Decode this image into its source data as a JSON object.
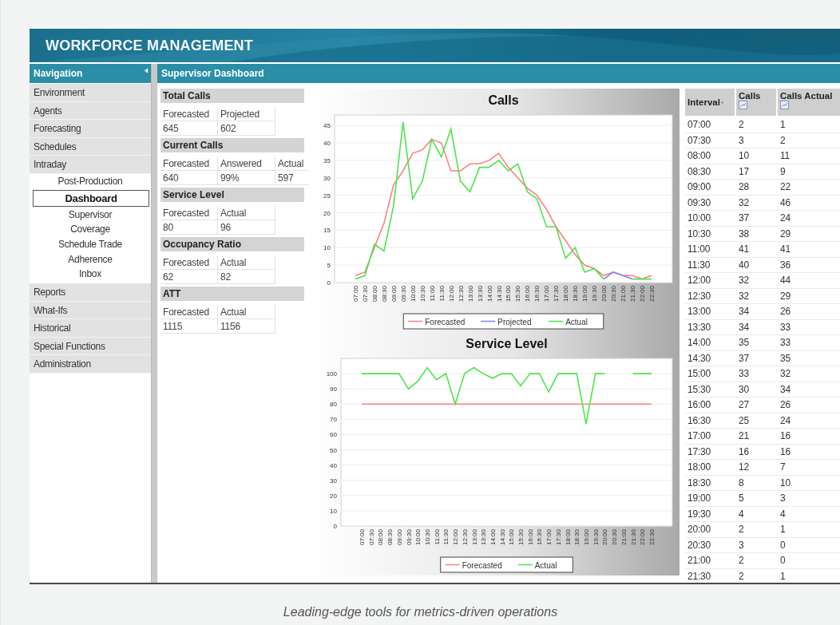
{
  "header": {
    "title": "WORKFORCE MANAGEMENT"
  },
  "navigation": {
    "title": "Navigation",
    "items": [
      {
        "label": "Environment",
        "selected": false
      },
      {
        "label": "Agents",
        "selected": false
      },
      {
        "label": "Forecasting",
        "selected": false
      },
      {
        "label": "Schedules",
        "selected": false
      },
      {
        "label": "Intraday",
        "selected": false,
        "children": [
          {
            "label": "Post-Production",
            "selected": false
          },
          {
            "label": "Dashboard",
            "selected": true
          },
          {
            "label": "Supervisor",
            "selected": false
          },
          {
            "label": "Coverage",
            "selected": false
          },
          {
            "label": "Schedule Trade",
            "selected": false
          },
          {
            "label": "Adherence",
            "selected": false
          },
          {
            "label": "Inbox",
            "selected": false
          }
        ]
      },
      {
        "label": "Reports",
        "selected": false
      },
      {
        "label": "What-Ifs",
        "selected": false
      },
      {
        "label": "Historical",
        "selected": false
      },
      {
        "label": "Special Functions",
        "selected": false
      },
      {
        "label": "Administration",
        "selected": false
      }
    ]
  },
  "panel": {
    "title": "Supervisor Dashboard"
  },
  "metrics": [
    {
      "title": "Total Calls",
      "columns": [
        "Forecasted",
        "Projected"
      ],
      "values": [
        "645",
        "602"
      ]
    },
    {
      "title": "Current Calls",
      "columns": [
        "Forecasted",
        "Answered",
        "Actual"
      ],
      "values": [
        "640",
        "99%",
        "597"
      ]
    },
    {
      "title": "Service Level",
      "columns": [
        "Forecasted",
        "Actual"
      ],
      "values": [
        "80",
        "96"
      ]
    },
    {
      "title": "Occupancy Ratio",
      "columns": [
        "Forecasted",
        "Actual"
      ],
      "values": [
        "62",
        "82"
      ]
    },
    {
      "title": "ATT",
      "columns": [
        "Forecasted",
        "Actual"
      ],
      "values": [
        "1115",
        "1156"
      ]
    }
  ],
  "charts": [
    {
      "chart_data": {
        "type": "line",
        "title": "Calls",
        "categories": [
          "07:00",
          "07:30",
          "08:00",
          "08:30",
          "09:00",
          "09:30",
          "10:00",
          "10:30",
          "11:00",
          "11:30",
          "12:00",
          "12:30",
          "13:00",
          "13:30",
          "14:00",
          "14:30",
          "15:00",
          "15:30",
          "16:00",
          "16:30",
          "17:00",
          "17:30",
          "18:00",
          "18:30",
          "19:00",
          "19:30",
          "20:00",
          "20:30",
          "21:00",
          "21:30",
          "22:00",
          "22:30"
        ],
        "series": [
          {
            "name": "Forecasted",
            "color": "#ff7f7f",
            "values": [
              2,
              3,
              10,
              17,
              28,
              32,
              37,
              38,
              41,
              40,
              32,
              32,
              34,
              34,
              35,
              37,
              33,
              30,
              27,
              25,
              21,
              16,
              12,
              8,
              5,
              4,
              2,
              3,
              2,
              2,
              1,
              2
            ]
          },
          {
            "name": "Projected",
            "color": "#7f7fff",
            "values": [
              null,
              null,
              null,
              null,
              null,
              null,
              null,
              null,
              null,
              null,
              null,
              null,
              null,
              null,
              null,
              null,
              null,
              null,
              null,
              null,
              null,
              null,
              null,
              null,
              null,
              null,
              1,
              3,
              2,
              1,
              null,
              null
            ]
          },
          {
            "name": "Actual",
            "color": "#4ee44e",
            "values": [
              1,
              2,
              11,
              9,
              22,
              46,
              24,
              29,
              41,
              36,
              44,
              29,
              26,
              33,
              33,
              35,
              32,
              34,
              26,
              24,
              16,
              16,
              7,
              10,
              3,
              4,
              1,
              null,
              null,
              1,
              1,
              1
            ]
          }
        ],
        "ylim": [
          0,
          48
        ],
        "yticks": [
          0,
          5,
          10,
          15,
          20,
          25,
          30,
          35,
          40,
          45
        ],
        "grid": true,
        "legend": "bottom"
      }
    },
    {
      "chart_data": {
        "type": "line",
        "title": "Service Level",
        "categories": [
          "07:00",
          "07:30",
          "08:00",
          "08:30",
          "09:00",
          "09:30",
          "10:00",
          "10:30",
          "11:00",
          "11:30",
          "12:00",
          "12:30",
          "13:00",
          "13:30",
          "14:00",
          "14:30",
          "15:00",
          "15:30",
          "16:00",
          "16:30",
          "17:00",
          "17:30",
          "18:00",
          "18:30",
          "19:00",
          "19:30",
          "20:00",
          "20:30",
          "21:00",
          "21:30",
          "22:00",
          "22:30"
        ],
        "series": [
          {
            "name": "Forecasted",
            "color": "#ff7f7f",
            "values": [
              80,
              80,
              80,
              80,
              80,
              80,
              80,
              80,
              80,
              80,
              80,
              80,
              80,
              80,
              80,
              80,
              80,
              80,
              80,
              80,
              80,
              80,
              80,
              80,
              80,
              80,
              80,
              80,
              80,
              80,
              80,
              80
            ]
          },
          {
            "name": "Actual",
            "color": "#4ee44e",
            "values": [
              100,
              100,
              100,
              100,
              100,
              90,
              95,
              104,
              96,
              100,
              80,
              100,
              104,
              100,
              97,
              100,
              100,
              92,
              100,
              100,
              88,
              100,
              100,
              100,
              67,
              100,
              100,
              null,
              null,
              100,
              100,
              100
            ]
          }
        ],
        "ylim": [
          0,
          110
        ],
        "yticks": [
          0,
          10,
          20,
          30,
          40,
          50,
          60,
          70,
          80,
          90,
          100
        ],
        "grid": true,
        "legend": "bottom"
      }
    }
  ],
  "table": {
    "columns": [
      {
        "label": "Interval",
        "kind": "sort"
      },
      {
        "label": "Calls",
        "kind": "chart"
      },
      {
        "label": "Calls Actual",
        "kind": "chart"
      }
    ],
    "rows": [
      [
        "07:00",
        "2",
        "1"
      ],
      [
        "07:30",
        "3",
        "2"
      ],
      [
        "08:00",
        "10",
        "11"
      ],
      [
        "08:30",
        "17",
        "9"
      ],
      [
        "09:00",
        "28",
        "22"
      ],
      [
        "09:30",
        "32",
        "46"
      ],
      [
        "10:00",
        "37",
        "24"
      ],
      [
        "10:30",
        "38",
        "29"
      ],
      [
        "11:00",
        "41",
        "41"
      ],
      [
        "11:30",
        "40",
        "36"
      ],
      [
        "12:00",
        "32",
        "44"
      ],
      [
        "12:30",
        "32",
        "29"
      ],
      [
        "13:00",
        "34",
        "26"
      ],
      [
        "13:30",
        "34",
        "33"
      ],
      [
        "14:00",
        "35",
        "33"
      ],
      [
        "14:30",
        "37",
        "35"
      ],
      [
        "15:00",
        "33",
        "32"
      ],
      [
        "15:30",
        "30",
        "34"
      ],
      [
        "16:00",
        "27",
        "26"
      ],
      [
        "16:30",
        "25",
        "24"
      ],
      [
        "17:00",
        "21",
        "16"
      ],
      [
        "17:30",
        "16",
        "16"
      ],
      [
        "18:00",
        "12",
        "7"
      ],
      [
        "18:30",
        "8",
        "10"
      ],
      [
        "19:00",
        "5",
        "3"
      ],
      [
        "19:30",
        "4",
        "4"
      ],
      [
        "20:00",
        "2",
        "1"
      ],
      [
        "20:30",
        "3",
        "0"
      ],
      [
        "21:00",
        "2",
        "0"
      ],
      [
        "21:30",
        "2",
        "1"
      ]
    ]
  },
  "caption": "Leading-edge tools for metrics-driven operations"
}
